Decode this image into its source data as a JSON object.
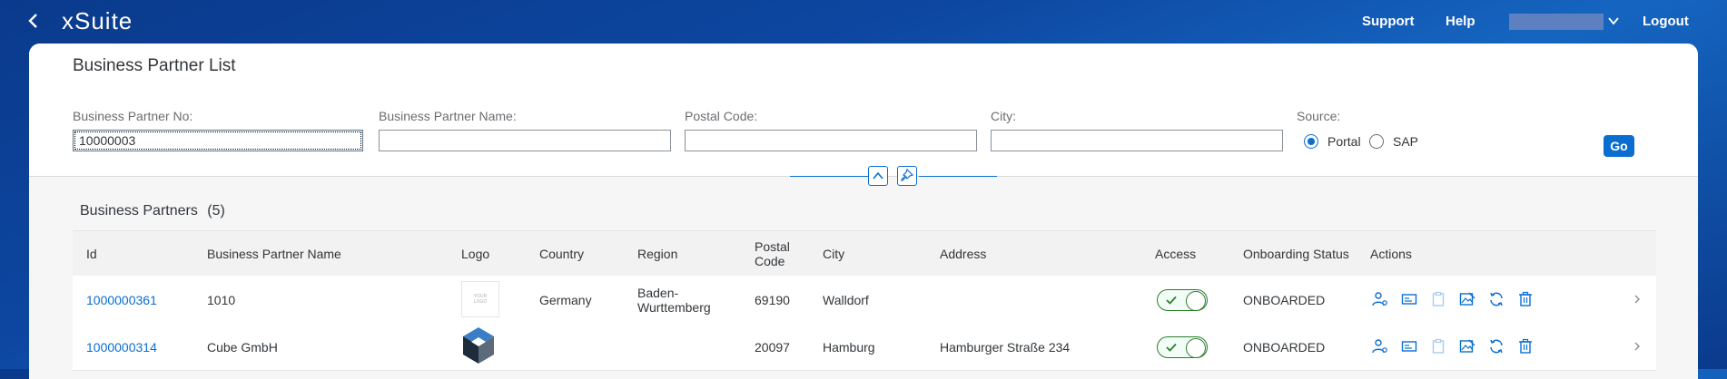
{
  "header": {
    "app_name": "xSuite",
    "support_label": "Support",
    "help_label": "Help",
    "logout_label": "Logout"
  },
  "filter": {
    "title": "Business Partner List",
    "bp_no_label": "Business Partner No:",
    "bp_no_value": "10000003",
    "bp_name_label": "Business Partner Name:",
    "bp_name_value": "",
    "postal_label": "Postal Code:",
    "postal_value": "",
    "city_label": "City:",
    "city_value": "",
    "source_label": "Source:",
    "source_options": [
      "Portal",
      "SAP"
    ],
    "source_selected": "Portal",
    "go_label": "Go"
  },
  "table": {
    "title": "Business Partners",
    "count": "(5)",
    "columns": {
      "id": "Id",
      "name": "Business Partner Name",
      "logo": "Logo",
      "country": "Country",
      "region": "Region",
      "postal_line1": "Postal",
      "postal_line2": "Code",
      "city": "City",
      "address": "Address",
      "access": "Access",
      "status": "Onboarding Status",
      "actions": "Actions"
    },
    "rows": [
      {
        "id": "1000000361",
        "name": "1010",
        "logo_text_1": "YOUR",
        "logo_text_2": "LOGO",
        "country": "Germany",
        "region_1": "Baden-",
        "region_2": "Wurttemberg",
        "postal": "69190",
        "city": "Walldorf",
        "address": "",
        "access": true,
        "status": "ONBOARDED"
      },
      {
        "id": "1000000314",
        "name": "Cube GmbH",
        "country": "",
        "region_1": "",
        "region_2": "",
        "postal": "20097",
        "city": "Hamburg",
        "address": "Hamburger Straße 234",
        "access": true,
        "status": "ONBOARDED"
      }
    ]
  },
  "colors": {
    "accent": "#0a6ed1",
    "success": "#2b7d2b"
  }
}
